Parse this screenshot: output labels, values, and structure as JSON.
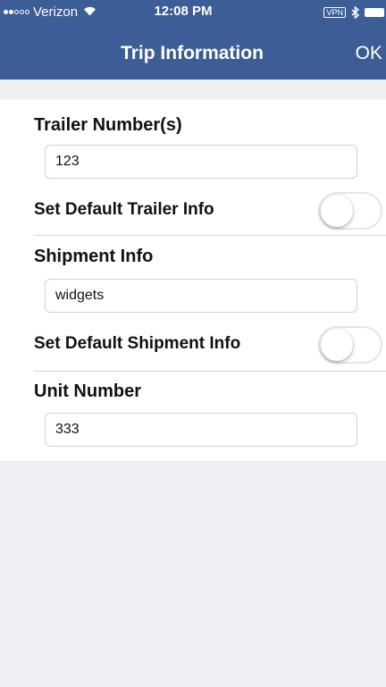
{
  "status_bar": {
    "carrier": "Verizon",
    "time": "12:08 PM",
    "vpn": "VPN",
    "signal_bars_filled": 2,
    "signal_bars_total": 5
  },
  "nav": {
    "title": "Trip Information",
    "ok_label": "OK"
  },
  "form": {
    "trailer": {
      "label": "Trailer Number(s)",
      "value": "123"
    },
    "default_trailer": {
      "label": "Set Default Trailer Info",
      "on": false
    },
    "shipment": {
      "label": "Shipment Info",
      "value": "widgets"
    },
    "default_shipment": {
      "label": "Set Default Shipment Info",
      "on": false
    },
    "unit": {
      "label": "Unit Number",
      "value": "333"
    }
  },
  "colors": {
    "nav_background": "#3d5d96",
    "page_background": "#efeff4",
    "toggle_border": "#e5e5ea"
  }
}
